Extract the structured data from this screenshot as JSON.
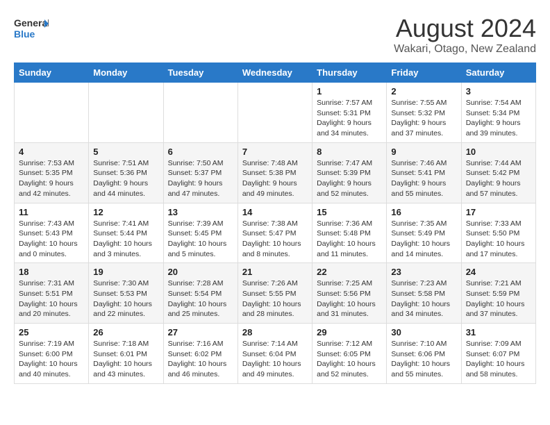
{
  "header": {
    "logo": {
      "line1": "General",
      "line2": "Blue"
    },
    "month": "August 2024",
    "location": "Wakari, Otago, New Zealand"
  },
  "weekdays": [
    "Sunday",
    "Monday",
    "Tuesday",
    "Wednesday",
    "Thursday",
    "Friday",
    "Saturday"
  ],
  "weeks": [
    [
      {
        "day": "",
        "info": ""
      },
      {
        "day": "",
        "info": ""
      },
      {
        "day": "",
        "info": ""
      },
      {
        "day": "",
        "info": ""
      },
      {
        "day": "1",
        "info": "Sunrise: 7:57 AM\nSunset: 5:31 PM\nDaylight: 9 hours\nand 34 minutes."
      },
      {
        "day": "2",
        "info": "Sunrise: 7:55 AM\nSunset: 5:32 PM\nDaylight: 9 hours\nand 37 minutes."
      },
      {
        "day": "3",
        "info": "Sunrise: 7:54 AM\nSunset: 5:34 PM\nDaylight: 9 hours\nand 39 minutes."
      }
    ],
    [
      {
        "day": "4",
        "info": "Sunrise: 7:53 AM\nSunset: 5:35 PM\nDaylight: 9 hours\nand 42 minutes."
      },
      {
        "day": "5",
        "info": "Sunrise: 7:51 AM\nSunset: 5:36 PM\nDaylight: 9 hours\nand 44 minutes."
      },
      {
        "day": "6",
        "info": "Sunrise: 7:50 AM\nSunset: 5:37 PM\nDaylight: 9 hours\nand 47 minutes."
      },
      {
        "day": "7",
        "info": "Sunrise: 7:48 AM\nSunset: 5:38 PM\nDaylight: 9 hours\nand 49 minutes."
      },
      {
        "day": "8",
        "info": "Sunrise: 7:47 AM\nSunset: 5:39 PM\nDaylight: 9 hours\nand 52 minutes."
      },
      {
        "day": "9",
        "info": "Sunrise: 7:46 AM\nSunset: 5:41 PM\nDaylight: 9 hours\nand 55 minutes."
      },
      {
        "day": "10",
        "info": "Sunrise: 7:44 AM\nSunset: 5:42 PM\nDaylight: 9 hours\nand 57 minutes."
      }
    ],
    [
      {
        "day": "11",
        "info": "Sunrise: 7:43 AM\nSunset: 5:43 PM\nDaylight: 10 hours\nand 0 minutes."
      },
      {
        "day": "12",
        "info": "Sunrise: 7:41 AM\nSunset: 5:44 PM\nDaylight: 10 hours\nand 3 minutes."
      },
      {
        "day": "13",
        "info": "Sunrise: 7:39 AM\nSunset: 5:45 PM\nDaylight: 10 hours\nand 5 minutes."
      },
      {
        "day": "14",
        "info": "Sunrise: 7:38 AM\nSunset: 5:47 PM\nDaylight: 10 hours\nand 8 minutes."
      },
      {
        "day": "15",
        "info": "Sunrise: 7:36 AM\nSunset: 5:48 PM\nDaylight: 10 hours\nand 11 minutes."
      },
      {
        "day": "16",
        "info": "Sunrise: 7:35 AM\nSunset: 5:49 PM\nDaylight: 10 hours\nand 14 minutes."
      },
      {
        "day": "17",
        "info": "Sunrise: 7:33 AM\nSunset: 5:50 PM\nDaylight: 10 hours\nand 17 minutes."
      }
    ],
    [
      {
        "day": "18",
        "info": "Sunrise: 7:31 AM\nSunset: 5:51 PM\nDaylight: 10 hours\nand 20 minutes."
      },
      {
        "day": "19",
        "info": "Sunrise: 7:30 AM\nSunset: 5:53 PM\nDaylight: 10 hours\nand 22 minutes."
      },
      {
        "day": "20",
        "info": "Sunrise: 7:28 AM\nSunset: 5:54 PM\nDaylight: 10 hours\nand 25 minutes."
      },
      {
        "day": "21",
        "info": "Sunrise: 7:26 AM\nSunset: 5:55 PM\nDaylight: 10 hours\nand 28 minutes."
      },
      {
        "day": "22",
        "info": "Sunrise: 7:25 AM\nSunset: 5:56 PM\nDaylight: 10 hours\nand 31 minutes."
      },
      {
        "day": "23",
        "info": "Sunrise: 7:23 AM\nSunset: 5:58 PM\nDaylight: 10 hours\nand 34 minutes."
      },
      {
        "day": "24",
        "info": "Sunrise: 7:21 AM\nSunset: 5:59 PM\nDaylight: 10 hours\nand 37 minutes."
      }
    ],
    [
      {
        "day": "25",
        "info": "Sunrise: 7:19 AM\nSunset: 6:00 PM\nDaylight: 10 hours\nand 40 minutes."
      },
      {
        "day": "26",
        "info": "Sunrise: 7:18 AM\nSunset: 6:01 PM\nDaylight: 10 hours\nand 43 minutes."
      },
      {
        "day": "27",
        "info": "Sunrise: 7:16 AM\nSunset: 6:02 PM\nDaylight: 10 hours\nand 46 minutes."
      },
      {
        "day": "28",
        "info": "Sunrise: 7:14 AM\nSunset: 6:04 PM\nDaylight: 10 hours\nand 49 minutes."
      },
      {
        "day": "29",
        "info": "Sunrise: 7:12 AM\nSunset: 6:05 PM\nDaylight: 10 hours\nand 52 minutes."
      },
      {
        "day": "30",
        "info": "Sunrise: 7:10 AM\nSunset: 6:06 PM\nDaylight: 10 hours\nand 55 minutes."
      },
      {
        "day": "31",
        "info": "Sunrise: 7:09 AM\nSunset: 6:07 PM\nDaylight: 10 hours\nand 58 minutes."
      }
    ]
  ]
}
